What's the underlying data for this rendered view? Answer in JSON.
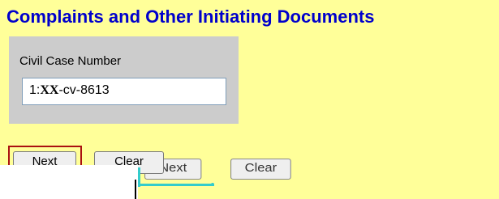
{
  "header": {
    "title": "Complaints and Other Initiating Documents"
  },
  "case_panel": {
    "label": "Civil Case Number",
    "input_prefix": "1:",
    "input_xx": "XX",
    "input_suffix": "-cv-8613"
  },
  "buttons": {
    "next_label": "Next",
    "clear_label": "Clear"
  },
  "colors": {
    "background": "#ffff99",
    "title": "#0000cc",
    "panel": "#cccccc",
    "highlight": "#aa1111",
    "accent_cyan": "#33cccc"
  }
}
